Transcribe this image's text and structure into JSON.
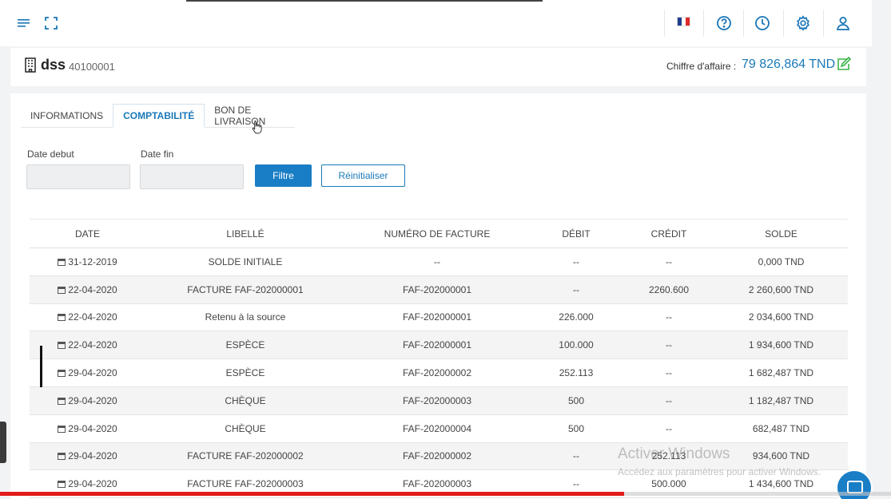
{
  "topbar": {
    "icons": [
      "menu-icon",
      "fullscreen-icon",
      "flag-france-icon",
      "help-icon",
      "history-icon",
      "settings-icon",
      "user-icon"
    ],
    "accent": "#1976b8"
  },
  "client": {
    "name": "dss",
    "code": "40100001",
    "revenue_label": "Chiffre d'affaire :",
    "revenue_value": "79 826,864 TND"
  },
  "tabs": [
    {
      "label": "INFORMATIONS",
      "active": false
    },
    {
      "label": "COMPTABILITÉ",
      "active": true
    },
    {
      "label": "BON DE LIVRAISON",
      "active": false
    }
  ],
  "filters": {
    "date_debut_label": "Date debut",
    "date_fin_label": "Date fin",
    "date_debut_value": "",
    "date_fin_value": "",
    "filter_button": "Filtre",
    "reset_button": "Réinitialiser"
  },
  "table": {
    "headers": [
      "DATE",
      "LIBELLÉ",
      "NUMÉRO DE FACTURE",
      "DÉBIT",
      "CRÉDIT",
      "SOLDE"
    ],
    "rows": [
      [
        "31-12-2019",
        "SOLDE INITIALE",
        "--",
        "--",
        "--",
        "0,000 TND"
      ],
      [
        "22-04-2020",
        "FACTURE FAF-202000001",
        "FAF-202000001",
        "--",
        "2260.600",
        "2 260,600 TND"
      ],
      [
        "22-04-2020",
        "Retenu à la source",
        "FAF-202000001",
        "226.000",
        "--",
        "2 034,600 TND"
      ],
      [
        "22-04-2020",
        "ESPÈCE",
        "FAF-202000001",
        "100.000",
        "--",
        "1 934,600 TND"
      ],
      [
        "29-04-2020",
        "ESPÈCE",
        "FAF-202000002",
        "252.113",
        "--",
        "1 682,487 TND"
      ],
      [
        "29-04-2020",
        "CHÈQUE",
        "FAF-202000003",
        "500",
        "--",
        "1 182,487 TND"
      ],
      [
        "29-04-2020",
        "CHÈQUE",
        "FAF-202000004",
        "500",
        "--",
        "682,487 TND"
      ],
      [
        "29-04-2020",
        "FACTURE FAF-202000002",
        "FAF-202000002",
        "--",
        "252.113",
        "934,600 TND"
      ],
      [
        "29-04-2020",
        "FACTURE FAF-202000003",
        "FAF-202000003",
        "--",
        "500.000",
        "1 434,600 TND"
      ]
    ]
  },
  "watermark": {
    "line1": "Activer Windows",
    "line2": "Accédez aux paramètres pour activer Windows."
  },
  "video_progress": 0.7
}
